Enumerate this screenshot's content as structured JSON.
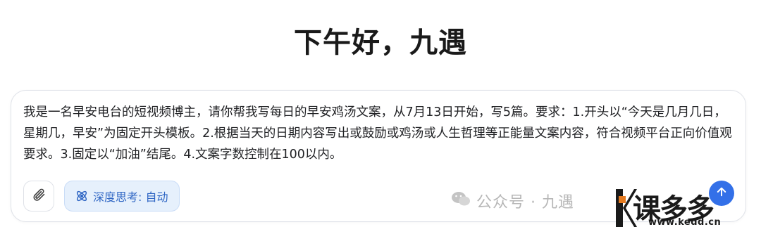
{
  "greeting": "下午好，九遇",
  "composer": {
    "prompt_text": "我是一名早安电台的短视频博主，请你帮我写每日的早安鸡汤文案，从7月13日开始，写5篇。要求：1.开头以“今天是几月几日，星期几，早安”为固定开头模板。2.根据当天的日期内容写出或鼓励或鸡汤或人生哲理等正能量文案内容，符合视频平台正向价值观要求。3.固定以“加油”结尾。4.文案字数控制在100以内。",
    "deep_think_label": "深度思考: 自动",
    "icons": {
      "attach": "paperclip-icon",
      "deep_think": "atom-icon",
      "send": "arrow-up-icon"
    },
    "colors": {
      "deep_think_bg": "#e6f0fc",
      "deep_think_text": "#2f66c4",
      "send_bg": "#3370e8"
    }
  },
  "watermark": {
    "text": "公众号 · 九遇"
  },
  "logo": {
    "brand": "课多多",
    "site": "www.kedd.cn"
  }
}
